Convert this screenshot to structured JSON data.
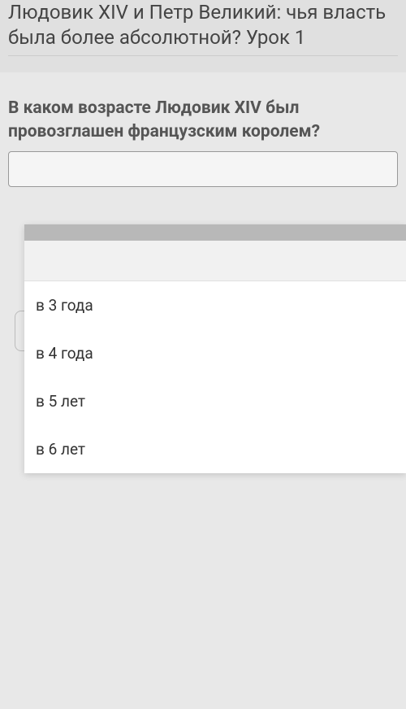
{
  "lesson": {
    "title": "Людовик XIV и Петр Великий: чья власть была более абсолютной? Урок 1"
  },
  "question": {
    "text": "В каком возрасте Людовик XIV был провозглашен французским королем?",
    "value": ""
  },
  "dropdown": {
    "options": [
      {
        "label": "в 3 года"
      },
      {
        "label": "в 4 года"
      },
      {
        "label": "в 5 лет"
      },
      {
        "label": "в 6 лет"
      }
    ]
  }
}
